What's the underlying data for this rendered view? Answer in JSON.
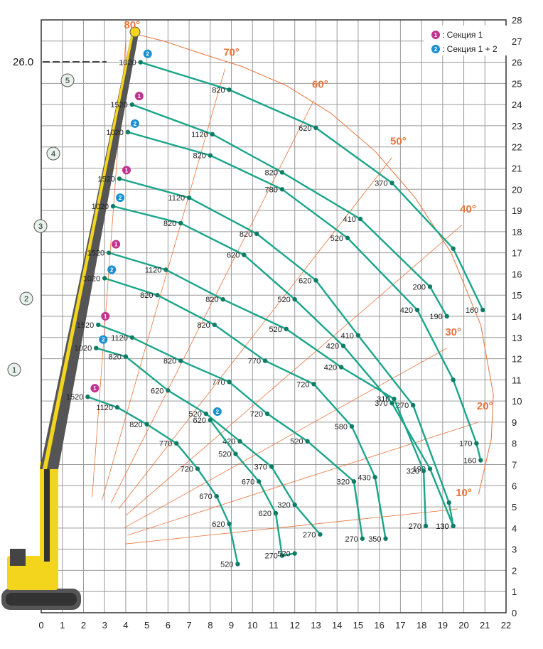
{
  "chart_data": {
    "type": "line",
    "xlim": [
      0,
      22
    ],
    "ylim": [
      0,
      28
    ],
    "x_ticks": [
      "0",
      "1",
      "2",
      "3",
      "4",
      "5",
      "6",
      "7",
      "8",
      "9",
      "10",
      "11",
      "12",
      "13",
      "14",
      "15",
      "16",
      "17",
      "18",
      "19",
      "20",
      "21",
      "22"
    ],
    "y_ticks": [
      "0",
      "1",
      "2",
      "3",
      "4",
      "5",
      "6",
      "7",
      "8",
      "9",
      "10",
      "11",
      "12",
      "13",
      "14",
      "15",
      "16",
      "17",
      "18",
      "19",
      "20",
      "21",
      "22",
      "23",
      "24",
      "25",
      "26",
      "27",
      "28"
    ],
    "grid": true,
    "height_marker": "26.0",
    "legend": [
      {
        "badge": "1",
        "text": ": Секция 1",
        "color": "#c0338e"
      },
      {
        "badge": "2",
        "text": ": Секция 1 + 2",
        "color": "#1a8fd1"
      }
    ],
    "boom_stages": [
      "1",
      "2",
      "3",
      "4",
      "5"
    ],
    "angles": [
      {
        "label": "80°",
        "x": 4.3,
        "y": 27.6
      },
      {
        "label": "70°",
        "x": 9.0,
        "y": 26.3
      },
      {
        "label": "60°",
        "x": 13.2,
        "y": 24.8
      },
      {
        "label": "50°",
        "x": 16.9,
        "y": 22.1
      },
      {
        "label": "40°",
        "x": 20.2,
        "y": 18.9
      },
      {
        "label": "30°",
        "x": 19.5,
        "y": 13.1
      },
      {
        "label": "20°",
        "x": 21.0,
        "y": 9.6
      },
      {
        "label": "10°",
        "x": 20.0,
        "y": 5.5
      }
    ],
    "series": [
      {
        "section": "2",
        "points": [
          [
            4.7,
            26.0,
            "1020"
          ],
          [
            8.9,
            24.7,
            "820"
          ],
          [
            13.0,
            22.9,
            "620"
          ],
          [
            16.6,
            20.3,
            "370"
          ],
          [
            19.5,
            17.2,
            ""
          ],
          [
            20.9,
            14.3,
            "160"
          ]
        ]
      },
      {
        "section": "1",
        "points": [
          [
            4.3,
            24.0,
            "1520"
          ],
          [
            8.1,
            22.6,
            "1120"
          ],
          [
            11.4,
            20.8,
            "820"
          ],
          [
            15.1,
            18.6,
            "410"
          ],
          [
            18.4,
            15.4,
            "200"
          ],
          [
            19.2,
            14.0,
            "190"
          ]
        ]
      },
      {
        "section": "2",
        "points": [
          [
            4.1,
            22.7,
            "1020"
          ],
          [
            8.0,
            21.6,
            "820"
          ],
          [
            11.4,
            20.0,
            "780"
          ],
          [
            14.5,
            17.7,
            "520"
          ],
          [
            17.8,
            14.3,
            "420"
          ],
          [
            19.5,
            11.0,
            ""
          ],
          [
            20.6,
            8.0,
            "170"
          ],
          [
            20.8,
            7.2,
            "160"
          ]
        ]
      },
      {
        "section": "1",
        "points": [
          [
            3.7,
            20.5,
            "1520"
          ],
          [
            7.0,
            19.6,
            "1120"
          ],
          [
            10.2,
            17.9,
            "820"
          ],
          [
            13.0,
            15.7,
            "620"
          ],
          [
            15.0,
            13.1,
            "410"
          ],
          [
            17.6,
            9.8,
            "270"
          ],
          [
            19.3,
            5.2,
            ""
          ],
          [
            19.5,
            4.1,
            "130"
          ]
        ]
      },
      {
        "section": "2",
        "points": [
          [
            3.4,
            19.2,
            "1020"
          ],
          [
            6.6,
            18.4,
            "820"
          ],
          [
            9.6,
            16.9,
            "620"
          ],
          [
            12.0,
            14.8,
            "520"
          ],
          [
            14.3,
            12.6,
            "420"
          ],
          [
            16.6,
            9.9,
            "370"
          ],
          [
            18.4,
            6.8,
            "190"
          ],
          [
            19.5,
            4.1,
            "130"
          ]
        ]
      },
      {
        "section": "1",
        "points": [
          [
            3.2,
            17.0,
            "1520"
          ],
          [
            5.9,
            16.2,
            "1120"
          ],
          [
            8.6,
            14.8,
            "820"
          ],
          [
            11.6,
            13.4,
            "520"
          ],
          [
            14.2,
            11.6,
            "420"
          ],
          [
            16.7,
            10.1,
            "310"
          ],
          [
            18.1,
            6.7,
            "320"
          ],
          [
            18.2,
            4.1,
            "270"
          ]
        ]
      },
      {
        "section": "2",
        "points": [
          [
            3.0,
            15.8,
            "1020"
          ],
          [
            5.5,
            15.0,
            "820"
          ],
          [
            8.2,
            13.6,
            "820"
          ],
          [
            10.6,
            11.9,
            "770"
          ],
          [
            12.9,
            10.8,
            "720"
          ],
          [
            14.7,
            8.8,
            "580"
          ],
          [
            15.8,
            6.4,
            "430"
          ],
          [
            16.3,
            3.5,
            "350"
          ]
        ]
      },
      {
        "section": "1",
        "points": [
          [
            2.7,
            13.6,
            "1520"
          ],
          [
            4.3,
            13.0,
            "1120"
          ],
          [
            6.6,
            11.9,
            "820"
          ],
          [
            8.9,
            10.9,
            "770"
          ],
          [
            10.7,
            9.4,
            "720"
          ],
          [
            12.6,
            8.1,
            "520"
          ],
          [
            14.8,
            6.2,
            "320"
          ],
          [
            15.2,
            3.5,
            "270"
          ]
        ]
      },
      {
        "section": "2",
        "points": [
          [
            2.6,
            12.5,
            "1020"
          ],
          [
            4.0,
            12.1,
            "820"
          ],
          [
            6.0,
            10.5,
            "620"
          ],
          [
            7.8,
            9.4,
            "520"
          ],
          [
            9.4,
            8.1,
            "420"
          ],
          [
            10.9,
            6.9,
            "370"
          ],
          [
            12.0,
            5.1,
            "320"
          ],
          [
            13.2,
            3.7,
            "270"
          ]
        ]
      },
      {
        "section": "1",
        "points": [
          [
            2.2,
            10.2,
            "1520"
          ],
          [
            3.6,
            9.7,
            "1120"
          ],
          [
            5.0,
            8.9,
            "820"
          ],
          [
            6.4,
            8.0,
            "770"
          ],
          [
            7.4,
            6.8,
            "720"
          ],
          [
            8.3,
            5.5,
            "670"
          ],
          [
            8.9,
            4.2,
            "620"
          ],
          [
            9.3,
            2.3,
            "520"
          ]
        ]
      },
      {
        "section": "2",
        "points": [
          [
            8.0,
            9.1,
            "620"
          ],
          [
            9.2,
            7.5,
            "520"
          ],
          [
            10.3,
            6.2,
            "670"
          ],
          [
            11.1,
            4.7,
            "620"
          ],
          [
            11.4,
            2.7,
            "270"
          ],
          [
            12.0,
            2.8,
            "520"
          ]
        ]
      }
    ]
  }
}
